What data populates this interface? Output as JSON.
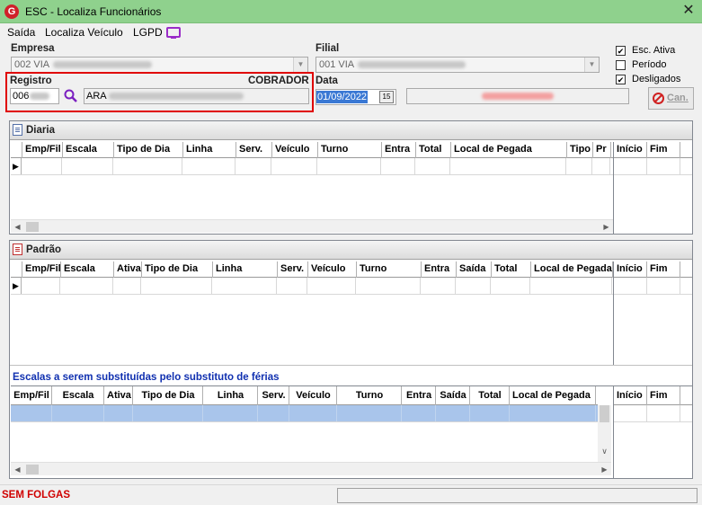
{
  "window": {
    "title": "ESC - Localiza Funcionários",
    "icon_letter": "G",
    "close_glyph": "✕"
  },
  "menu": {
    "items": [
      "Saída",
      "Localiza Veículo",
      "LGPD"
    ]
  },
  "form": {
    "empresa_label": "Empresa",
    "empresa_value": "002 VIA",
    "filial_label": "Filial",
    "filial_value": "001 VIA",
    "registro_label": "Registro",
    "cargo_label": "COBRADOR",
    "registro_value": "006",
    "nome_value": "ARA",
    "data_label": "Data",
    "data_value": "01/09/2022",
    "calendar_glyph": "15"
  },
  "options": {
    "esc_ativa": {
      "label": "Esc. Ativa",
      "checked": true
    },
    "periodo": {
      "label": "Período",
      "checked": false
    },
    "desligados": {
      "label": "Desligados",
      "checked": true
    }
  },
  "buttons": {
    "cancel_label": "Can."
  },
  "diaria": {
    "title": "Diaria",
    "columns": [
      "Emp/Fil",
      "Escala",
      "Tipo de Dia",
      "Linha",
      "Serv.",
      "Veículo",
      "Turno",
      "Entra",
      "Total",
      "Local de Pegada",
      "Tipo",
      "Pr"
    ],
    "side_columns": [
      "Início",
      "Fim"
    ]
  },
  "padrao": {
    "title": "Padrão",
    "columns": [
      "Emp/Fil",
      "Escala",
      "Ativa",
      "Tipo de Dia",
      "Linha",
      "Serv.",
      "Veículo",
      "Turno",
      "Entra",
      "Saída",
      "Total",
      "Local de Pegada"
    ],
    "side_columns": [
      "Início",
      "Fim"
    ]
  },
  "escalas": {
    "title": "Escalas a serem substituídas pelo substituto de férias",
    "columns": [
      "Emp/Fil",
      "Escala",
      "Ativa",
      "Tipo de Dia",
      "Linha",
      "Serv.",
      "Veículo",
      "Turno",
      "Entra",
      "Saída",
      "Total",
      "Local de Pegada"
    ],
    "side_columns": [
      "Início",
      "Fim"
    ]
  },
  "status": {
    "text": "SEM FOLGAS"
  },
  "colors": {
    "accent_titlebar": "#8fd18d",
    "highlight_border": "#e00000",
    "selected_row": "#a9c5eb",
    "status_red": "#d00000",
    "section_blue": "#1030b0"
  }
}
